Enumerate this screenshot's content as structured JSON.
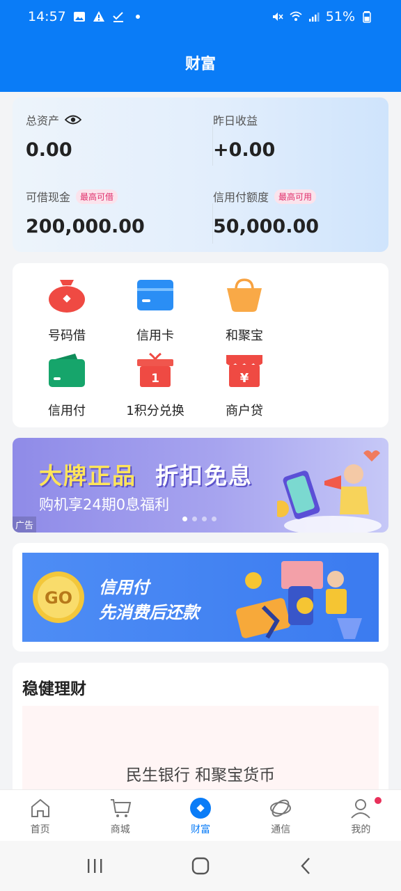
{
  "status_bar": {
    "time": "14:57",
    "battery": "51%"
  },
  "header": {
    "title": "财富"
  },
  "assets": {
    "total_assets_label": "总资产",
    "total_assets_value": "0.00",
    "yesterday_income_label": "昨日收益",
    "yesterday_income_value": "+0.00",
    "cash_loan_label": "可借现金",
    "cash_loan_tag": "最高可借",
    "cash_loan_value": "200,000.00",
    "credit_pay_label": "信用付额度",
    "credit_pay_tag": "最高可用",
    "credit_pay_value": "50,000.00"
  },
  "services": [
    {
      "label": "号码借",
      "icon": "money-bag-icon"
    },
    {
      "label": "信用卡",
      "icon": "credit-card-icon"
    },
    {
      "label": "和聚宝",
      "icon": "basket-icon"
    },
    {
      "label": "信用付",
      "icon": "wallet-icon"
    },
    {
      "label": "1积分兑换",
      "icon": "gift-box-icon"
    },
    {
      "label": "商户贷",
      "icon": "merchant-loan-icon"
    }
  ],
  "banner_ad": {
    "title_part1": "大牌正品",
    "title_part2": "折扣免息",
    "subtitle": "购机享24期0息福利",
    "ad_tag": "广告",
    "slides": 4,
    "active_slide": 1
  },
  "credit_banner": {
    "badge": "GO",
    "line1": "信用付",
    "line2": "先消费后还款"
  },
  "finance": {
    "title": "稳健理财",
    "product": "民生银行 和聚宝货币"
  },
  "tabbar": {
    "items": [
      {
        "label": "首页",
        "icon": "home-icon"
      },
      {
        "label": "商城",
        "icon": "mall-cart-icon"
      },
      {
        "label": "财富",
        "icon": "wealth-icon"
      },
      {
        "label": "通信",
        "icon": "china-mobile-icon"
      },
      {
        "label": "我的",
        "icon": "user-icon"
      }
    ],
    "active": "财富"
  },
  "colors": {
    "brand_blue": "#0a7cf7",
    "tag_pink": "#e0306c"
  }
}
